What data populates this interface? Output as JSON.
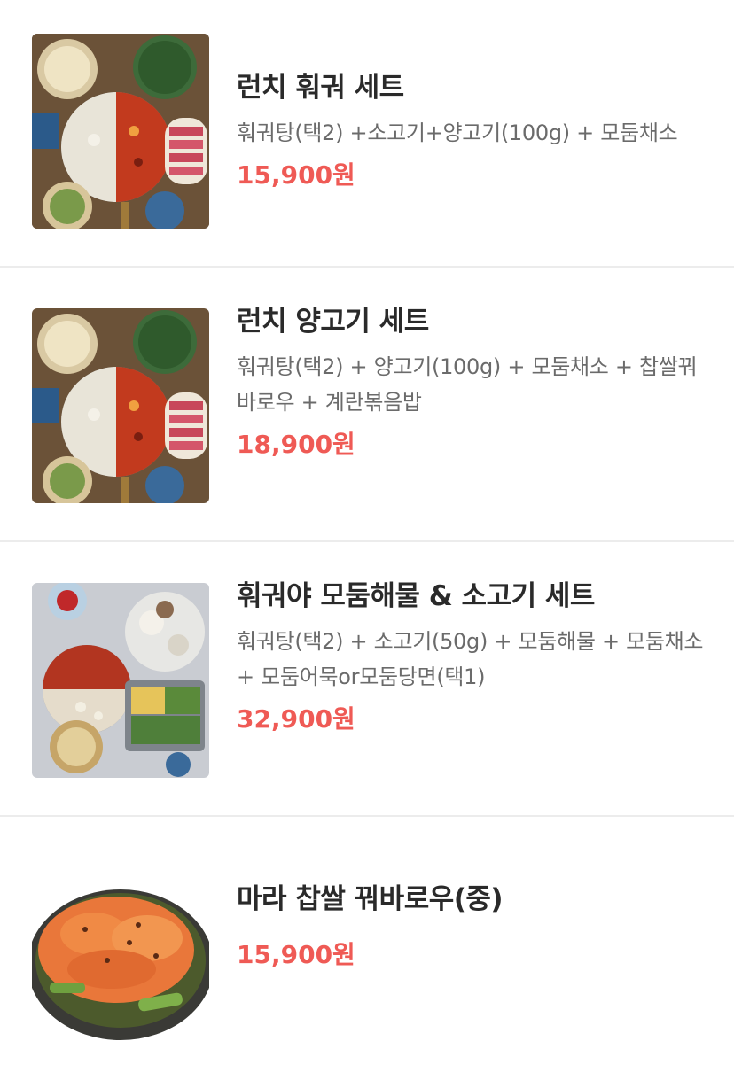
{
  "menu_items": [
    {
      "name": "런치 훠궈 세트",
      "description": "훠궈탕(택2) +소고기+양고기(100g) + 모둠채소",
      "price": "15,900원",
      "image": "hotpot-spread-photo"
    },
    {
      "name": "런치 양고기 세트",
      "description": "훠궈탕(택2) + 양고기(100g) + 모둠채소 + 찹쌀꿔바로우 + 계란볶음밥",
      "price": "18,900원",
      "image": "hotpot-spread-photo"
    },
    {
      "name": "훠궈야 모둠해물 & 소고기 세트",
      "description": "훠궈탕(택2) + 소고기(50g) + 모둠해물 + 모둠채소 + 모둠어묵or모둠당면(택1)",
      "price": "32,900원",
      "image": "seafood-hotpot-photo"
    },
    {
      "name": "마라 찹쌀 꿔바로우(중)",
      "description": "",
      "price": "15,900원",
      "image": "sweet-sour-pork-photo"
    }
  ],
  "colors": {
    "price": "#ef5a55",
    "name": "#2a2a2a",
    "description": "#6b6b6b",
    "divider": "#ececec"
  }
}
